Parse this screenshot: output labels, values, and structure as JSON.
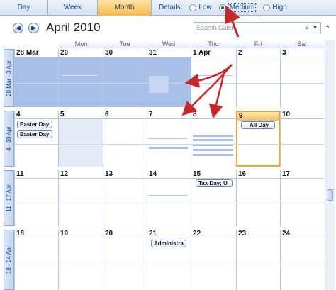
{
  "toolbar": {
    "tabs": [
      "Day",
      "Week",
      "Month"
    ],
    "active_tab": "Month",
    "details_label": "Details:",
    "details_options": [
      "Low",
      "Medium",
      "High"
    ],
    "details_selected": "Medium"
  },
  "header": {
    "title": "April 2010",
    "search_placeholder": "Search Calen"
  },
  "weekdays": [
    "Mon",
    "Tue",
    "Wed",
    "Thu",
    "Fri",
    "Sat"
  ],
  "weeks": [
    {
      "label": "28 Mar - 3 Apr",
      "days": [
        "28 Mar",
        "29",
        "30",
        "31",
        "1 Apr",
        "2",
        "3"
      ]
    },
    {
      "label": "4 - 10 Apr",
      "days": [
        "4",
        "5",
        "6",
        "7",
        "8",
        "9",
        "10"
      ]
    },
    {
      "label": "11 - 17 Apr",
      "days": [
        "11",
        "12",
        "13",
        "14",
        "15",
        "16",
        "17"
      ]
    },
    {
      "label": "18 - 24 Apr",
      "days": [
        "18",
        "19",
        "20",
        "21",
        "22",
        "23",
        "24"
      ]
    }
  ],
  "appointments": {
    "easter_day_1": "Easter Day",
    "easter_day_2": "Easter Day",
    "all_day": "All Day",
    "tax_day": "Tax Day; U",
    "administra": "Administra"
  },
  "colors": {
    "accent": "#f7b94c",
    "selection": "#a8bfe8",
    "border": "#b6c6e4",
    "annotation_arrow": "#c62828"
  }
}
